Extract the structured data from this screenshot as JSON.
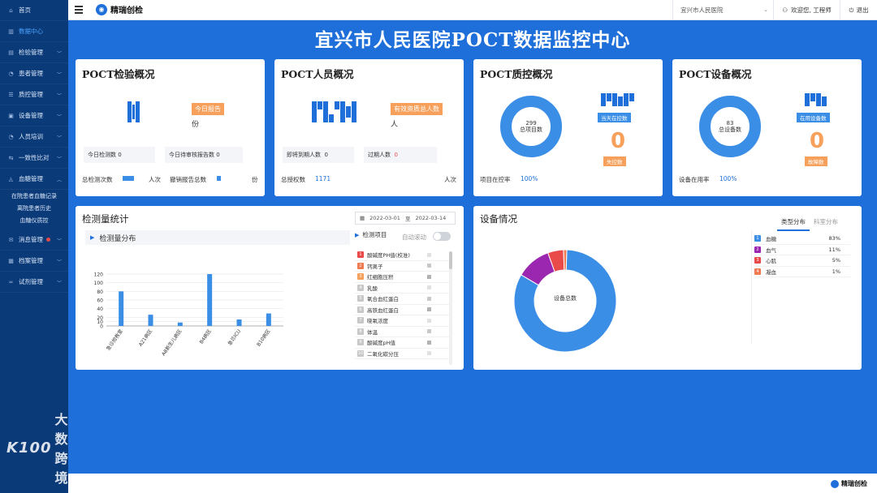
{
  "sidebar": {
    "items": [
      {
        "label": "首页",
        "icon": "home-icon",
        "glyph": "⌂",
        "chevron": false,
        "active": false
      },
      {
        "label": "数据中心",
        "icon": "chart-icon",
        "glyph": "▥",
        "chevron": false,
        "active": true
      },
      {
        "label": "检验管理",
        "icon": "document-icon",
        "glyph": "▤",
        "chevron": true,
        "active": false
      },
      {
        "label": "患者管理",
        "icon": "user-icon",
        "glyph": "◔",
        "chevron": true,
        "active": false
      },
      {
        "label": "质控管理",
        "icon": "sliders-icon",
        "glyph": "☰",
        "chevron": true,
        "active": false
      },
      {
        "label": "设备管理",
        "icon": "device-icon",
        "glyph": "▣",
        "chevron": true,
        "active": false
      },
      {
        "label": "人员培训",
        "icon": "person-icon",
        "glyph": "◔",
        "chevron": true,
        "active": false
      },
      {
        "label": "一致性比对",
        "icon": "compare-icon",
        "glyph": "⇆",
        "chevron": true,
        "active": false
      },
      {
        "label": "血糖管理",
        "icon": "drop-icon",
        "glyph": "◬",
        "chevron": true,
        "active": false,
        "expanded": true
      }
    ],
    "sub_items": [
      "在院患者血糖记录",
      "离院患者历史",
      "血糖仪质控"
    ],
    "items_after": [
      {
        "label": "消息管理",
        "icon": "message-icon",
        "glyph": "✉",
        "chevron": true,
        "badge": true
      },
      {
        "label": "档案管理",
        "icon": "folder-icon",
        "glyph": "▦",
        "chevron": true,
        "badge": false
      },
      {
        "label": "试剂管理",
        "icon": "link-icon",
        "glyph": "∞",
        "chevron": true,
        "badge": false
      }
    ],
    "watermark_text": "大数跨境",
    "watermark_logo": "K100"
  },
  "topbar": {
    "brand": "精瑞创检",
    "hospital": "宜兴市人民医院",
    "user": "欢迎您, 工程师",
    "logout": "退出"
  },
  "page_title": "宜兴市人民医院POCT数据监控中心",
  "test_card": {
    "title": "POCT检验概况",
    "tag": "今日报告",
    "unit": "份",
    "today_tests_label": "今日检测数",
    "today_tests_value": "0",
    "pending_label": "今日待审核报告数",
    "pending_value": "0",
    "total_label": "总检测次数",
    "total_unit": "人次",
    "revoked_label": "撤销报告总数",
    "revoked_unit": "份"
  },
  "staff_card": {
    "title": "POCT人员概况",
    "tag": "有效资质总人数",
    "unit": "人",
    "expiring_label": "即将到期人数",
    "expiring_value": "0",
    "expired_label": "过期人数",
    "expired_value": "0",
    "authorized_label": "总授权数",
    "authorized_value": "1171",
    "authorized_unit": "人次"
  },
  "qc_card": {
    "title": "POCT质控概况",
    "donut_value": "299",
    "donut_label": "总项目数",
    "tag_top": "当天在控数",
    "zero_value": "0",
    "tag_bottom": "失控数",
    "rate_label": "项目在控率",
    "rate_value": "100%"
  },
  "device_card": {
    "title": "POCT设备概况",
    "donut_value": "83",
    "donut_label": "总设备数",
    "tag_top": "在用设备数",
    "zero_value": "0",
    "tag_bottom": "故障数",
    "rate_label": "设备在用率",
    "rate_value": "100%"
  },
  "volume_card": {
    "title": "检测量统计",
    "date_start": "2022-03-01",
    "date_sep": "至",
    "date_end": "2022-03-14",
    "subhead": "检测量分布",
    "project_label": "检测项目",
    "auto_scroll": "自动滚动",
    "projects": [
      {
        "n": "1",
        "name": "酸碱度PH值(校准)",
        "color": "#e94b4b"
      },
      {
        "n": "2",
        "name": "钙离子",
        "color": "#f07a52"
      },
      {
        "n": "3",
        "name": "红细胞压积",
        "color": "#f6a05b"
      },
      {
        "n": "4",
        "name": "乳酸",
        "color": "#c8c8c8"
      },
      {
        "n": "5",
        "name": "氧合血红蛋白",
        "color": "#c8c8c8"
      },
      {
        "n": "6",
        "name": "高铁血红蛋白",
        "color": "#c8c8c8"
      },
      {
        "n": "7",
        "name": "晓氧浓度",
        "color": "#c8c8c8"
      },
      {
        "n": "8",
        "name": "体温",
        "color": "#c8c8c8"
      },
      {
        "n": "9",
        "name": "酸碱度pH值",
        "color": "#c8c8c8"
      },
      {
        "n": "10",
        "name": "二氧化碳分压",
        "color": "#c8c8c8"
      }
    ]
  },
  "equip_card": {
    "title": "设备情况",
    "tab_type": "类型分布",
    "tab_dept": "科室分布",
    "donut_label": "设备总数",
    "legend": [
      {
        "n": "1",
        "name": "血糖",
        "pct": "83%",
        "color": "#3a8ee6"
      },
      {
        "n": "2",
        "name": "血气",
        "pct": "11%",
        "color": "#9b27b0"
      },
      {
        "n": "3",
        "name": "心肌",
        "pct": "5%",
        "color": "#e94b4b"
      },
      {
        "n": "4",
        "name": "凝血",
        "pct": "1%",
        "color": "#f07a52"
      }
    ]
  },
  "chart_data": [
    {
      "type": "bar",
      "categories": [
        "急诊抢救室",
        "A21病区",
        "A8新生儿病区",
        "B4病区",
        "急诊ICU",
        "B10病区"
      ],
      "values": [
        80,
        26,
        8,
        120,
        15,
        29
      ],
      "ylim": [
        0,
        120
      ],
      "yticks": [
        0,
        10,
        20,
        40,
        60,
        80,
        100,
        120
      ],
      "color": "#3a8ee6"
    },
    {
      "type": "pie",
      "labels": [
        "血糖",
        "血气",
        "心肌",
        "凝血"
      ],
      "values": [
        83,
        11,
        5,
        1
      ],
      "colors": [
        "#3a8ee6",
        "#9b27b0",
        "#e94b4b",
        "#f07a52"
      ]
    }
  ],
  "footer": {
    "brand": "精瑞创检"
  }
}
